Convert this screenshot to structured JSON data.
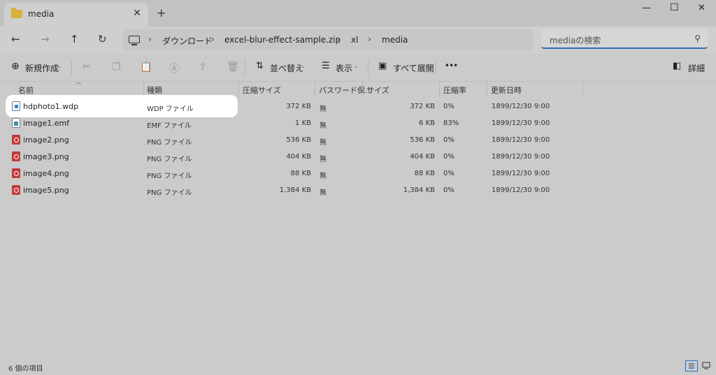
{
  "tab": {
    "title": "media",
    "new_tab": "+"
  },
  "window_controls": {
    "minimize": "—",
    "maximize": "☐",
    "close": "✕"
  },
  "nav": {
    "back": "←",
    "forward": "→",
    "up": "↑",
    "refresh": "↻"
  },
  "address": {
    "crumbs": [
      "ダウンロード",
      "excel-blur-effect-sample.zip",
      "xl",
      "media"
    ],
    "separator": "›"
  },
  "search": {
    "placeholder": "mediaの検索"
  },
  "toolbar": {
    "new_label": "新規作成",
    "sort_label": "並べ替え",
    "view_label": "表示",
    "extract_label": "すべて展開",
    "more_label": "•••",
    "details_label": "詳細"
  },
  "columns": {
    "name": "名前",
    "type": "種類",
    "compressed_size": "圧縮サイズ",
    "password": "パスワード保...",
    "size": "サイズ",
    "ratio": "圧縮率",
    "modified": "更新日時"
  },
  "files": [
    {
      "name": "hdphoto1.wdp",
      "type": "WDP ファイル",
      "compressed_size": "372 KB",
      "password": "無",
      "size": "372 KB",
      "ratio": "0%",
      "modified": "1899/12/30 9:00",
      "icon": "doc"
    },
    {
      "name": "image1.emf",
      "type": "EMF ファイル",
      "compressed_size": "1 KB",
      "password": "無",
      "size": "6 KB",
      "ratio": "83%",
      "modified": "1899/12/30 9:00",
      "icon": "emf"
    },
    {
      "name": "image2.png",
      "type": "PNG ファイル",
      "compressed_size": "536 KB",
      "password": "無",
      "size": "536 KB",
      "ratio": "0%",
      "modified": "1899/12/30 9:00",
      "icon": "png"
    },
    {
      "name": "image3.png",
      "type": "PNG ファイル",
      "compressed_size": "404 KB",
      "password": "無",
      "size": "404 KB",
      "ratio": "0%",
      "modified": "1899/12/30 9:00",
      "icon": "png"
    },
    {
      "name": "image4.png",
      "type": "PNG ファイル",
      "compressed_size": "88 KB",
      "password": "無",
      "size": "88 KB",
      "ratio": "0%",
      "modified": "1899/12/30 9:00",
      "icon": "png"
    },
    {
      "name": "image5.png",
      "type": "PNG ファイル",
      "compressed_size": "1,384 KB",
      "password": "無",
      "size": "1,384 KB",
      "ratio": "0%",
      "modified": "1899/12/30 9:00",
      "icon": "png"
    }
  ],
  "status": {
    "item_count": "6 個の項目"
  }
}
